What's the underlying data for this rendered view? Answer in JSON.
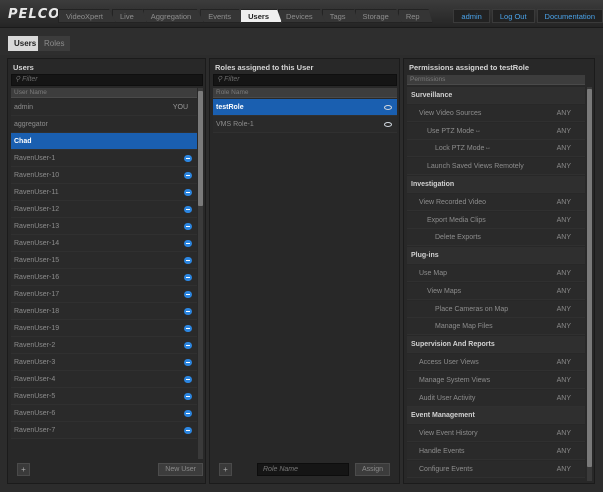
{
  "nav": {
    "logo": "PELCO",
    "tabs": [
      {
        "label": "VideoXpert"
      },
      {
        "label": "Live"
      },
      {
        "label": "Aggregation"
      },
      {
        "label": "Events"
      },
      {
        "label": "Users"
      },
      {
        "label": "Devices"
      },
      {
        "label": "Tags"
      },
      {
        "label": "Storage"
      },
      {
        "label": "Rep"
      }
    ],
    "active_tab": "Users",
    "user_links": [
      {
        "label": "admin"
      },
      {
        "label": "Log Out"
      },
      {
        "label": "Documentation"
      }
    ]
  },
  "subtabs": [
    {
      "label": "Users"
    },
    {
      "label": "Roles"
    }
  ],
  "users_panel": {
    "title": "Users",
    "filter_placeholder": "Filter",
    "column": "User Name",
    "rows": [
      {
        "name": "admin",
        "tail": "YOU"
      },
      {
        "name": "aggregator",
        "tail": ""
      },
      {
        "name": "Chad",
        "tail": "",
        "selected": true
      },
      {
        "name": "RavenUser-1",
        "tail": ""
      },
      {
        "name": "RavenUser-10",
        "tail": ""
      },
      {
        "name": "RavenUser-11",
        "tail": ""
      },
      {
        "name": "RavenUser-12",
        "tail": ""
      },
      {
        "name": "RavenUser-13",
        "tail": ""
      },
      {
        "name": "RavenUser-14",
        "tail": ""
      },
      {
        "name": "RavenUser-15",
        "tail": ""
      },
      {
        "name": "RavenUser-16",
        "tail": ""
      },
      {
        "name": "RavenUser-17",
        "tail": ""
      },
      {
        "name": "RavenUser-18",
        "tail": ""
      },
      {
        "name": "RavenUser-19",
        "tail": ""
      },
      {
        "name": "RavenUser-2",
        "tail": ""
      },
      {
        "name": "RavenUser-3",
        "tail": ""
      },
      {
        "name": "RavenUser-4",
        "tail": ""
      },
      {
        "name": "RavenUser-5",
        "tail": ""
      },
      {
        "name": "RavenUser-6",
        "tail": ""
      },
      {
        "name": "RavenUser-7",
        "tail": ""
      }
    ],
    "add_icon": "plus-icon",
    "new_user_label": "New User"
  },
  "roles_panel": {
    "title": "Roles assigned to this User",
    "filter_placeholder": "Filter",
    "column": "Role Name",
    "rows": [
      {
        "name": "testRole",
        "selected": true
      },
      {
        "name": "VMS Role-1",
        "selected": false
      }
    ],
    "add_icon": "plus-icon",
    "role_name_placeholder": "Role Name",
    "assign_label": "Assign"
  },
  "permissions_panel": {
    "title": "Permissions assigned to testRole",
    "column": "Permissions",
    "rows": [
      {
        "label": "Surveillance",
        "type": "category"
      },
      {
        "label": "View Video Sources",
        "level": 1,
        "scope": "ANY"
      },
      {
        "label": "Use PTZ Mode",
        "level": 2,
        "scope": "ANY"
      },
      {
        "label": "Lock PTZ Mode",
        "level": 3,
        "scope": "ANY"
      },
      {
        "label": "Launch Saved Views Remotely",
        "level": 2,
        "scope": "ANY"
      },
      {
        "label": "Investigation",
        "type": "category"
      },
      {
        "label": "View Recorded Video",
        "level": 1,
        "scope": "ANY"
      },
      {
        "label": "Export Media Clips",
        "level": 2,
        "scope": "ANY"
      },
      {
        "label": "Delete Exports",
        "level": 3,
        "scope": "ANY"
      },
      {
        "label": "Plug-ins",
        "type": "category"
      },
      {
        "label": "Use Map",
        "level": 1,
        "scope": "ANY"
      },
      {
        "label": "View Maps",
        "level": 2,
        "scope": "ANY"
      },
      {
        "label": "Place Cameras on Map",
        "level": 3,
        "scope": "ANY"
      },
      {
        "label": "Manage Map Files",
        "level": 3,
        "scope": "ANY"
      },
      {
        "label": "Supervision And Reports",
        "type": "category"
      },
      {
        "label": "Access User Views",
        "level": 1,
        "scope": "ANY"
      },
      {
        "label": "Manage System Views",
        "level": 1,
        "scope": "ANY"
      },
      {
        "label": "Audit User Activity",
        "level": 1,
        "scope": "ANY"
      },
      {
        "label": "Event Management",
        "type": "category"
      },
      {
        "label": "View Event History",
        "level": 1,
        "scope": "ANY"
      },
      {
        "label": "Handle Events",
        "level": 1,
        "scope": "ANY"
      },
      {
        "label": "Configure Events",
        "level": 1,
        "scope": "ANY"
      }
    ]
  },
  "colors": {
    "accent": "#1a5fb0",
    "badge": "#2b85e0",
    "link": "#4aa3ea"
  }
}
